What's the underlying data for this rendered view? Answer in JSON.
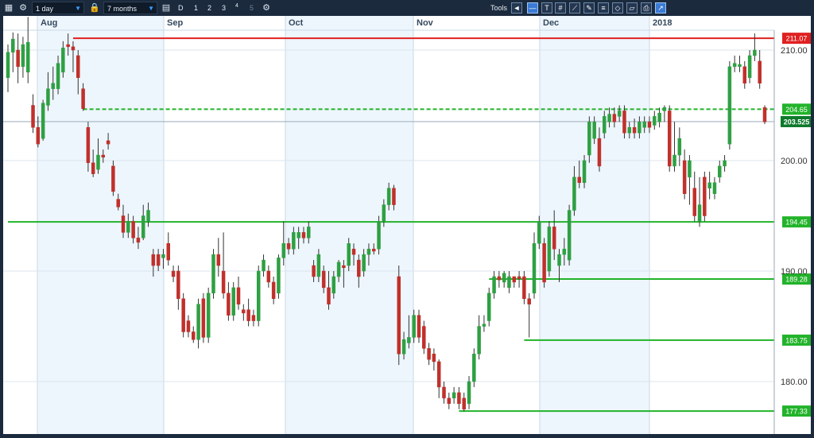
{
  "toolbar": {
    "interval": "1 day",
    "range": "7 months",
    "period_buttons": [
      "D",
      "1",
      "2",
      "3",
      "4",
      "5"
    ],
    "tools_label": "Tools"
  },
  "colors": {
    "up_candle": "#2ea043",
    "down_candle": "#c0302b",
    "resistance_line": "#e02020",
    "support_line": "#22b32a",
    "toolbar_bg": "#1b2a3d",
    "shaded_month": "#eef6fd"
  },
  "chart_data": {
    "type": "candlestick",
    "x_labels": [
      "Aug",
      "Sep",
      "Oct",
      "Nov",
      "Dec",
      "2018"
    ],
    "y_ticks": [
      "210.00",
      "200.00",
      "190.00",
      "180.00"
    ],
    "ylim": [
      175.5,
      213.5
    ],
    "current_price": "203.525",
    "horizontal_lines": [
      {
        "label": "211.07",
        "value": 211.07,
        "color": "#e02020",
        "style": "solid"
      },
      {
        "label": "204.65",
        "value": 204.65,
        "color": "#22b32a",
        "style": "dashed"
      },
      {
        "label": "194.45",
        "value": 194.45,
        "color": "#22b32a",
        "style": "solid"
      },
      {
        "label": "189.28",
        "value": 189.28,
        "color": "#22b32a",
        "style": "solid"
      },
      {
        "label": "183.75",
        "value": 183.75,
        "color": "#22b32a",
        "style": "solid"
      },
      {
        "label": "177.33",
        "value": 177.33,
        "color": "#22b32a",
        "style": "solid"
      }
    ],
    "candles": [
      [
        207.5,
        209.8,
        206.2,
        210.5,
        "up"
      ],
      [
        209.8,
        211.0,
        208.0,
        211.6,
        "up"
      ],
      [
        210.0,
        208.5,
        207.0,
        211.5,
        "down"
      ],
      [
        208.5,
        210.5,
        207.5,
        211.2,
        "up"
      ],
      [
        208.0,
        210.7,
        207.0,
        213.0,
        "up"
      ],
      [
        205.0,
        203.0,
        202.5,
        206.0,
        "down"
      ],
      [
        203.0,
        201.5,
        201.2,
        204.0,
        "down"
      ],
      [
        202.0,
        205.2,
        201.8,
        205.5,
        "up"
      ],
      [
        205.0,
        206.5,
        204.5,
        208.0,
        "up"
      ],
      [
        206.5,
        207.0,
        205.5,
        208.5,
        "up"
      ],
      [
        206.5,
        208.8,
        206.0,
        209.5,
        "up"
      ],
      [
        208.0,
        210.2,
        207.5,
        210.8,
        "up"
      ],
      [
        210.5,
        210.3,
        209.5,
        211.5,
        "down"
      ],
      [
        210.3,
        210.0,
        208.0,
        210.8,
        "down"
      ],
      [
        209.5,
        207.5,
        206.0,
        210.0,
        "down"
      ],
      [
        206.5,
        204.7,
        204.5,
        207.0,
        "down"
      ],
      [
        203.0,
        199.8,
        199.0,
        203.5,
        "down"
      ],
      [
        199.8,
        198.8,
        198.5,
        201.0,
        "down"
      ],
      [
        199.2,
        200.5,
        198.8,
        202.0,
        "up"
      ],
      [
        200.5,
        200.3,
        199.8,
        201.0,
        "down"
      ],
      [
        201.8,
        201.5,
        201.0,
        202.5,
        "down"
      ],
      [
        199.5,
        197.2,
        196.8,
        200.0,
        "down"
      ],
      [
        196.5,
        195.8,
        195.5,
        197.0,
        "down"
      ],
      [
        195.0,
        193.5,
        193.0,
        196.0,
        "down"
      ],
      [
        193.5,
        194.5,
        193.0,
        195.2,
        "up"
      ],
      [
        194.5,
        193.0,
        192.5,
        195.0,
        "down"
      ],
      [
        193.0,
        192.6,
        192.0,
        194.0,
        "down"
      ],
      [
        193.0,
        195.0,
        192.8,
        196.0,
        "up"
      ],
      [
        194.5,
        195.5,
        194.0,
        196.2,
        "up"
      ],
      [
        191.5,
        190.5,
        189.5,
        192.0,
        "down"
      ],
      [
        191.5,
        190.5,
        190.0,
        192.0,
        "down"
      ],
      [
        191.2,
        191.5,
        190.2,
        192.0,
        "up"
      ],
      [
        192.5,
        191.0,
        190.5,
        193.5,
        "down"
      ],
      [
        190.0,
        189.5,
        189.0,
        190.5,
        "down"
      ],
      [
        190.0,
        187.5,
        186.5,
        190.5,
        "down"
      ],
      [
        187.5,
        184.5,
        184.0,
        188.0,
        "down"
      ],
      [
        185.5,
        184.5,
        184.0,
        186.0,
        "down"
      ],
      [
        184.5,
        183.8,
        183.5,
        185.0,
        "down"
      ],
      [
        183.8,
        187.0,
        183.0,
        187.5,
        "up"
      ],
      [
        187.5,
        184.0,
        183.5,
        188.0,
        "down"
      ],
      [
        184.0,
        188.0,
        183.5,
        188.5,
        "up"
      ],
      [
        188.0,
        191.5,
        187.5,
        192.0,
        "up"
      ],
      [
        191.5,
        190.5,
        189.5,
        193.0,
        "down"
      ],
      [
        190.0,
        188.0,
        187.5,
        193.5,
        "down"
      ],
      [
        188.0,
        186.0,
        185.5,
        189.0,
        "down"
      ],
      [
        186.0,
        188.5,
        185.5,
        189.0,
        "up"
      ],
      [
        188.5,
        187.0,
        186.5,
        189.5,
        "down"
      ],
      [
        186.5,
        186.2,
        185.5,
        187.0,
        "down"
      ],
      [
        186.5,
        185.5,
        185.0,
        187.5,
        "down"
      ],
      [
        186.0,
        185.5,
        185.0,
        186.5,
        "down"
      ],
      [
        185.5,
        190.0,
        185.0,
        190.5,
        "up"
      ],
      [
        190.0,
        191.0,
        189.5,
        191.5,
        "up"
      ],
      [
        190.0,
        189.0,
        188.5,
        190.5,
        "down"
      ],
      [
        189.0,
        187.5,
        187.0,
        189.5,
        "down"
      ],
      [
        188.0,
        191.2,
        187.5,
        191.5,
        "up"
      ],
      [
        191.2,
        192.5,
        190.5,
        194.5,
        "up"
      ],
      [
        192.5,
        192.0,
        191.5,
        193.0,
        "down"
      ],
      [
        192.0,
        193.5,
        191.5,
        194.0,
        "up"
      ],
      [
        193.0,
        193.5,
        192.0,
        194.0,
        "up"
      ],
      [
        193.5,
        193.0,
        192.5,
        194.0,
        "down"
      ],
      [
        193.0,
        194.0,
        192.5,
        194.5,
        "up"
      ],
      [
        190.5,
        189.5,
        189.0,
        191.0,
        "down"
      ],
      [
        189.5,
        191.5,
        189.0,
        192.0,
        "up"
      ],
      [
        190.0,
        188.5,
        188.0,
        190.5,
        "down"
      ],
      [
        188.5,
        187.0,
        186.5,
        190.0,
        "down"
      ],
      [
        188.0,
        189.5,
        187.5,
        190.0,
        "up"
      ],
      [
        189.5,
        190.8,
        189.0,
        191.0,
        "up"
      ],
      [
        190.5,
        190.3,
        188.5,
        191.0,
        "down"
      ],
      [
        190.5,
        192.5,
        190.0,
        193.0,
        "up"
      ],
      [
        192.0,
        191.5,
        190.5,
        192.5,
        "down"
      ],
      [
        191.0,
        189.5,
        188.5,
        191.5,
        "down"
      ],
      [
        190.0,
        191.5,
        189.5,
        192.0,
        "up"
      ],
      [
        191.5,
        192.0,
        190.5,
        192.5,
        "up"
      ],
      [
        192.0,
        191.8,
        191.5,
        192.5,
        "down"
      ],
      [
        192.0,
        194.5,
        191.5,
        195.0,
        "up"
      ],
      [
        194.5,
        196.0,
        194.0,
        196.5,
        "up"
      ],
      [
        196.0,
        197.5,
        195.5,
        198.0,
        "up"
      ],
      [
        197.5,
        196.0,
        195.5,
        197.8,
        "down"
      ],
      [
        189.5,
        182.5,
        181.5,
        190.5,
        "down"
      ],
      [
        182.5,
        183.8,
        182.0,
        184.5,
        "up"
      ],
      [
        183.5,
        184.0,
        183.0,
        186.0,
        "up"
      ],
      [
        184.0,
        186.0,
        183.5,
        186.5,
        "up"
      ],
      [
        186.0,
        184.0,
        183.5,
        186.5,
        "down"
      ],
      [
        185.0,
        183.0,
        182.5,
        185.5,
        "down"
      ],
      [
        183.0,
        182.0,
        181.5,
        183.5,
        "down"
      ],
      [
        182.5,
        181.8,
        181.0,
        183.0,
        "down"
      ],
      [
        181.8,
        179.5,
        178.5,
        182.0,
        "down"
      ],
      [
        179.5,
        178.5,
        178.0,
        180.0,
        "down"
      ],
      [
        178.5,
        178.0,
        177.5,
        179.0,
        "down"
      ],
      [
        178.5,
        179.0,
        178.0,
        179.5,
        "up"
      ],
      [
        179.0,
        178.0,
        177.5,
        179.5,
        "down"
      ],
      [
        178.5,
        177.5,
        177.3,
        179.0,
        "down"
      ],
      [
        178.0,
        180.0,
        177.5,
        180.5,
        "up"
      ],
      [
        180.0,
        182.5,
        179.5,
        183.0,
        "up"
      ],
      [
        182.5,
        185.0,
        182.0,
        186.0,
        "up"
      ],
      [
        185.0,
        185.2,
        184.5,
        186.0,
        "up"
      ],
      [
        185.5,
        188.0,
        185.0,
        188.5,
        "up"
      ],
      [
        188.0,
        189.5,
        187.5,
        190.0,
        "up"
      ],
      [
        189.5,
        189.2,
        188.5,
        190.0,
        "down"
      ],
      [
        189.0,
        189.8,
        188.5,
        190.0,
        "up"
      ],
      [
        188.5,
        189.5,
        188.0,
        190.0,
        "up"
      ],
      [
        189.5,
        189.0,
        188.5,
        189.5,
        "down"
      ],
      [
        189.5,
        189.3,
        188.5,
        190.0,
        "down"
      ],
      [
        189.5,
        187.5,
        187.0,
        190.0,
        "down"
      ],
      [
        187.5,
        187.0,
        184.0,
        188.0,
        "down"
      ],
      [
        188.0,
        192.5,
        187.5,
        193.5,
        "up"
      ],
      [
        192.5,
        194.5,
        192.0,
        195.0,
        "up"
      ],
      [
        192.5,
        189.0,
        188.5,
        193.0,
        "down"
      ],
      [
        190.0,
        194.0,
        189.5,
        194.5,
        "up"
      ],
      [
        194.0,
        192.0,
        191.0,
        195.5,
        "down"
      ],
      [
        190.5,
        191.5,
        189.0,
        192.0,
        "up"
      ],
      [
        191.5,
        192.0,
        190.5,
        193.0,
        "up"
      ],
      [
        191.0,
        195.5,
        190.5,
        196.0,
        "up"
      ],
      [
        195.5,
        198.5,
        195.0,
        199.5,
        "up"
      ],
      [
        198.5,
        198.0,
        197.5,
        200.0,
        "down"
      ],
      [
        198.0,
        200.0,
        197.5,
        200.5,
        "up"
      ],
      [
        200.5,
        203.5,
        199.8,
        204.0,
        "up"
      ],
      [
        202.0,
        203.5,
        201.5,
        204.0,
        "up"
      ],
      [
        202.0,
        199.5,
        199.0,
        203.0,
        "down"
      ],
      [
        202.5,
        204.0,
        202.0,
        204.5,
        "up"
      ],
      [
        203.5,
        204.2,
        203.0,
        204.8,
        "up"
      ],
      [
        204.2,
        203.5,
        203.0,
        204.8,
        "down"
      ],
      [
        204.0,
        204.5,
        203.5,
        205.0,
        "up"
      ],
      [
        204.5,
        202.5,
        202.0,
        205.0,
        "down"
      ],
      [
        202.5,
        203.0,
        202.0,
        203.5,
        "up"
      ],
      [
        203.0,
        202.5,
        202.0,
        203.8,
        "down"
      ],
      [
        202.5,
        203.5,
        202.0,
        204.0,
        "up"
      ],
      [
        203.0,
        203.5,
        202.5,
        204.0,
        "up"
      ],
      [
        203.5,
        203.0,
        202.5,
        204.0,
        "down"
      ],
      [
        203.2,
        204.0,
        202.8,
        204.5,
        "up"
      ],
      [
        203.5,
        204.3,
        203.0,
        204.8,
        "up"
      ],
      [
        204.5,
        204.8,
        203.5,
        205.0,
        "up"
      ],
      [
        204.5,
        199.5,
        199.0,
        205.0,
        "down"
      ],
      [
        199.5,
        200.5,
        199.0,
        203.5,
        "up"
      ],
      [
        200.5,
        202.0,
        199.5,
        203.0,
        "up"
      ],
      [
        200.0,
        197.0,
        196.5,
        201.0,
        "down"
      ],
      [
        198.5,
        200.0,
        196.0,
        200.5,
        "up"
      ],
      [
        197.5,
        195.0,
        194.5,
        199.0,
        "down"
      ],
      [
        194.5,
        196.0,
        194.0,
        198.5,
        "up"
      ],
      [
        198.5,
        195.0,
        194.5,
        199.0,
        "down"
      ],
      [
        197.5,
        198.0,
        196.5,
        199.0,
        "up"
      ],
      [
        197.0,
        198.0,
        196.5,
        198.5,
        "up"
      ],
      [
        198.5,
        199.5,
        198.0,
        200.0,
        "up"
      ],
      [
        199.5,
        200.0,
        199.0,
        200.5,
        "up"
      ],
      [
        201.5,
        208.5,
        201.0,
        209.0,
        "up"
      ],
      [
        208.5,
        208.8,
        208.0,
        209.5,
        "up"
      ],
      [
        208.5,
        208.7,
        208.0,
        209.5,
        "up"
      ],
      [
        208.5,
        207.0,
        206.5,
        209.0,
        "down"
      ],
      [
        207.5,
        209.5,
        207.0,
        210.0,
        "up"
      ],
      [
        209.5,
        210.0,
        209.0,
        211.5,
        "up"
      ],
      [
        209.0,
        207.0,
        206.5,
        210.0,
        "down"
      ],
      [
        204.8,
        203.5,
        203.3,
        205.0,
        "down"
      ]
    ]
  }
}
